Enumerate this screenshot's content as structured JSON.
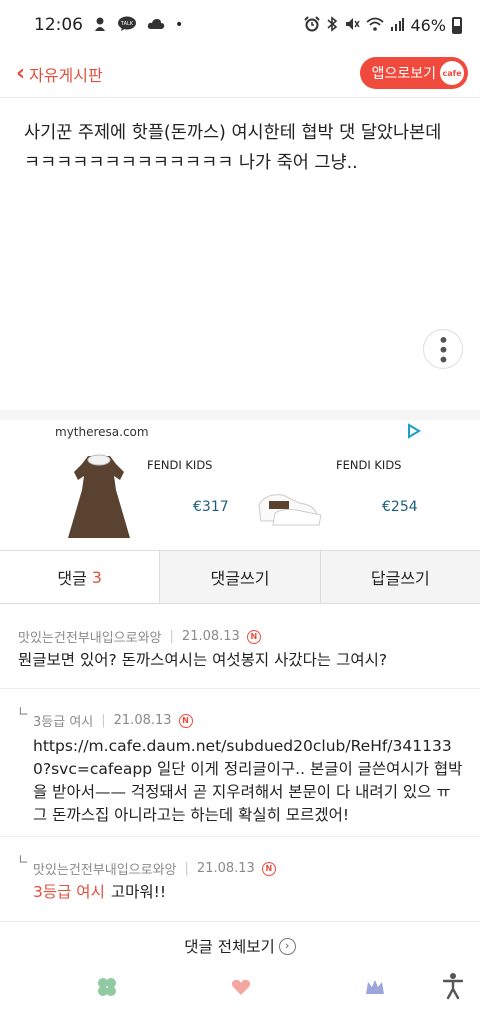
{
  "status_bar": {
    "time": "12:06",
    "battery": "46%",
    "dot": "•"
  },
  "header": {
    "back_label": "자유게시판",
    "app_button_label": "앱으로보기",
    "cafe_badge": "cafe"
  },
  "post": {
    "line1": "사기꾼 주제에 핫플(돈까스) 여시한테 협박 댓 달았나본데",
    "line2": "ㅋㅋㅋㅋㅋㅋㅋㅋㅋㅋㅋㅋㅋ 나가 죽어 그냥.."
  },
  "ad": {
    "domain": "mytheresa.com",
    "items": [
      {
        "brand": "FENDI KIDS",
        "price": "€317"
      },
      {
        "brand": "FENDI KIDS",
        "price": "€254"
      }
    ]
  },
  "tabs": {
    "comments_label": "댓글",
    "comments_count": "3",
    "write_comment": "댓글쓰기",
    "write_reply": "답글쓰기"
  },
  "comments": [
    {
      "author": "맛있는건전부내입으로와앙",
      "date": "21.08.13",
      "badge": "N",
      "text": "뭔글보면 있어? 돈까스여시는 여섯봉지 사갔다는 그여시?"
    },
    {
      "author": "3등급 여시",
      "date": "21.08.13",
      "badge": "N",
      "reply_mark": "∟",
      "text": "https://m.cafe.daum.net/subdued20club/ReHf/3411330?svc=cafeapp 일단 이게 정리글이구.. 본글이 글쓴여시가 협박을 받아서—— 걱정돼서 곧 지우려해서 본문이 다 내려기 있으 ㅠ 그 돈까스집 아니라고는 하는데 확실히 모르겠어!"
    },
    {
      "author": "맛있는건전부내입으로와앙",
      "date": "21.08.13",
      "badge": "N",
      "reply_mark": "∟",
      "mention": "3등급 여시",
      "text": "고마워!!"
    }
  ],
  "footer": {
    "all_comments_label": "댓글 전체보기",
    "chev": "›"
  },
  "colors": {
    "accent": "#e2503f",
    "button": "#f04a3d"
  },
  "bottom_icons": [
    "clover-icon",
    "heart-icon",
    "crown-icon",
    "accessibility-icon"
  ]
}
